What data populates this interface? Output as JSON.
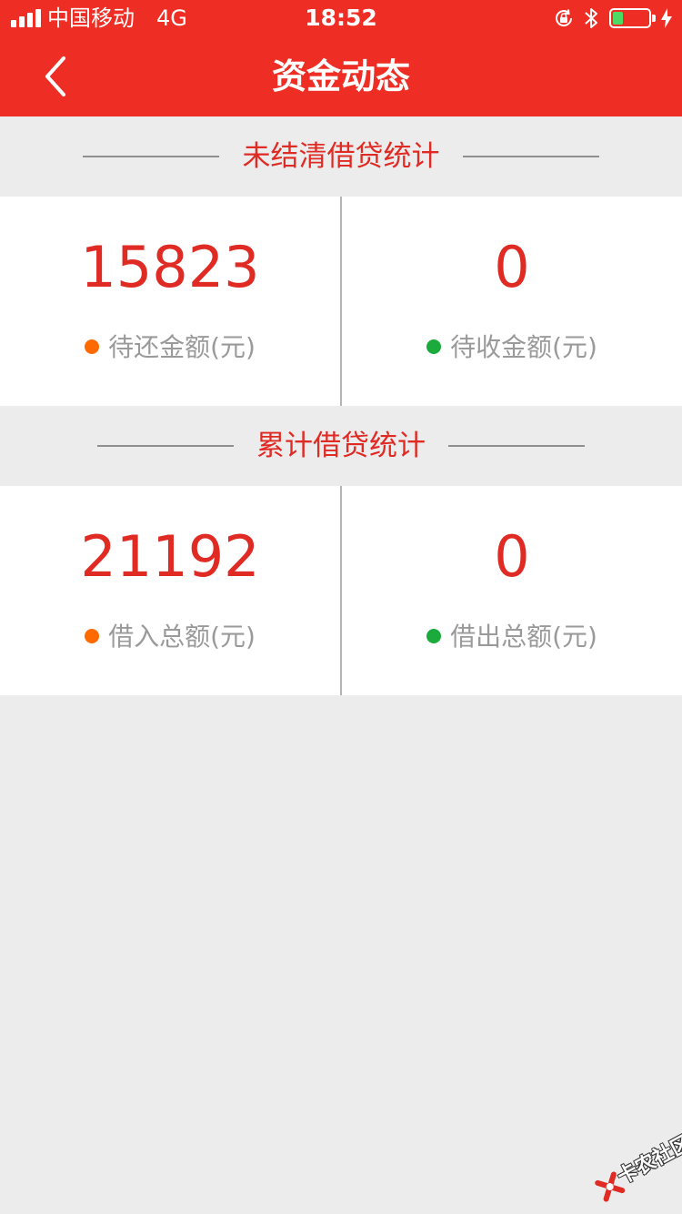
{
  "status_bar": {
    "carrier": "中国移动",
    "network": "4G",
    "time": "18:52",
    "battery_level": 0.3,
    "battery_color": "#4cd964"
  },
  "header": {
    "title": "资金动态",
    "back_icon": "chevron-left-icon",
    "background": "#ee2e24"
  },
  "sections": [
    {
      "title": "未结清借贷统计",
      "cells": [
        {
          "value": "15823",
          "label": "待还金额(元)",
          "dot_color": "#ff6a00"
        },
        {
          "value": "0",
          "label": "待收金额(元)",
          "dot_color": "#1aab3c"
        }
      ]
    },
    {
      "title": "累计借贷统计",
      "cells": [
        {
          "value": "21192",
          "label": "借入总额(元)",
          "dot_color": "#ff6a00"
        },
        {
          "value": "0",
          "label": "借出总额(元)",
          "dot_color": "#1aab3c"
        }
      ]
    }
  ],
  "watermark": {
    "text": "卡农社区"
  },
  "colors": {
    "accent": "#e02b25",
    "page_bg": "#ececec"
  }
}
